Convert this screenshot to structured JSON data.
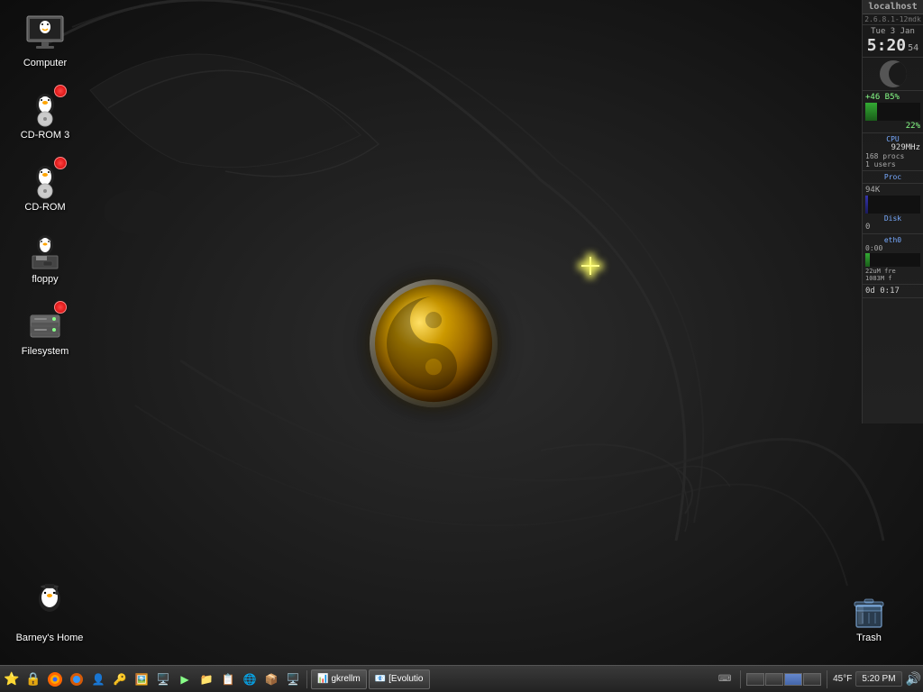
{
  "desktop": {
    "background_color": "#1a1a1a"
  },
  "icons": {
    "computer": {
      "label": "Computer"
    },
    "cdrom3": {
      "label": "CD-ROM 3"
    },
    "cdrom": {
      "label": "CD-ROM"
    },
    "floppy": {
      "label": "floppy"
    },
    "filesystem": {
      "label": "Filesystem"
    },
    "barneys_home": {
      "label": "Barney's Home"
    },
    "trash": {
      "label": "Trash"
    }
  },
  "gkrellm": {
    "hostname": "localhost",
    "kernel": "2.6.8.1-12mdk",
    "date": "Tue 3 Jan",
    "time": "5:20",
    "seconds": "54",
    "temp_line1": "+46 B5%",
    "cpu_usage": "22%",
    "cpu_label": "CPU",
    "cpu_freq": "929MHz",
    "procs": "168 procs",
    "users": "1 users",
    "proc_label": "Proc",
    "disk_val": "94K",
    "disk_label": "Disk",
    "disk_num": "0",
    "net_label": "eth0",
    "net_out": "0:00",
    "net_free": "22uM fre",
    "net_mem": "1083M f",
    "uptime": "0d 0:17"
  },
  "taskbar": {
    "icons": [
      "⭐",
      "🔒",
      "🦊",
      "🔥",
      "👤",
      "🔑",
      "🖼️",
      "🖥️",
      "▶️",
      "📁",
      "📋",
      "🌐",
      "📦",
      "🖥️"
    ],
    "windows": [
      {
        "label": "gkrellm",
        "icon": "📊"
      },
      {
        "label": "[Evolutio",
        "icon": "📧"
      }
    ],
    "temp": "45°F",
    "time": "5:20 PM",
    "pager_pages": 4,
    "active_page": 3
  }
}
